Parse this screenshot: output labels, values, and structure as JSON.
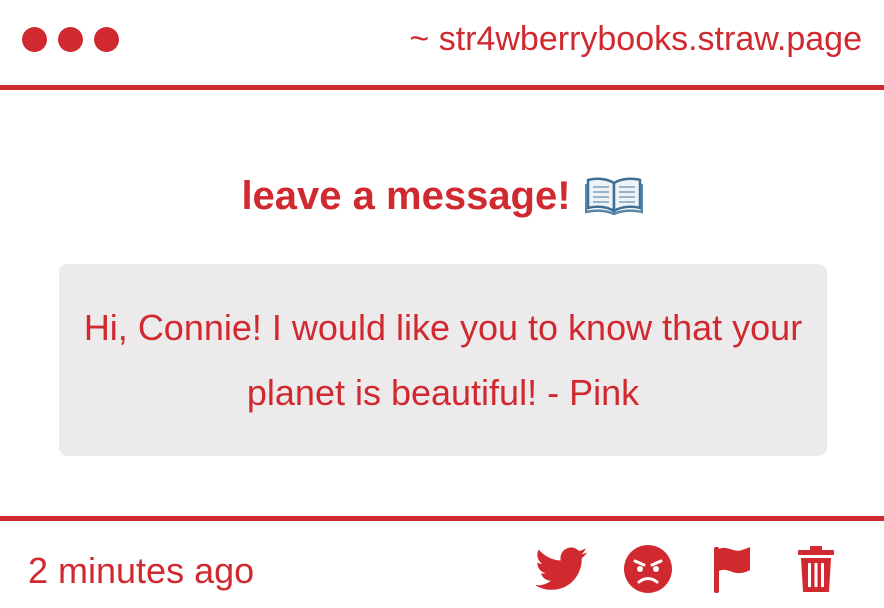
{
  "header": {
    "site_url": "~ str4wberrybooks.straw.page",
    "window_dots": [
      "dot-1",
      "dot-2",
      "dot-3"
    ]
  },
  "main": {
    "heading": "leave a message!",
    "heading_icon": "open-book-icon",
    "message": "Hi, Connie! I would like you to know that your planet is beautiful! - Pink"
  },
  "footer": {
    "timestamp": "2 minutes ago",
    "actions": [
      {
        "name": "share-twitter-button",
        "icon": "twitter-bird-icon"
      },
      {
        "name": "report-button",
        "icon": "angry-face-icon"
      },
      {
        "name": "flag-button",
        "icon": "flag-icon"
      },
      {
        "name": "delete-button",
        "icon": "trash-icon"
      }
    ]
  },
  "colors": {
    "accent": "#d0292f",
    "message_background": "#edeaec",
    "page_background": "#ffffff"
  }
}
